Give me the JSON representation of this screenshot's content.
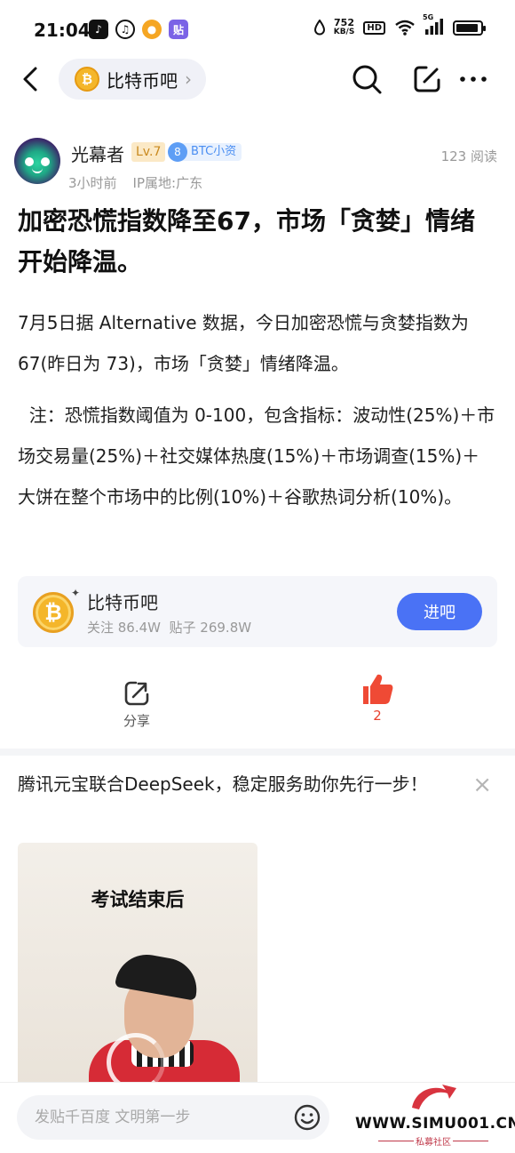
{
  "status_bar": {
    "time": "21:04",
    "speed_value": "752",
    "speed_unit": "KB/S",
    "hd": "HD",
    "network": "5G",
    "left_icons": [
      "tiktok-icon",
      "netease-icon",
      "weibo-icon",
      "tieba-icon"
    ],
    "right_icons": [
      "water-drop-icon",
      "wifi-icon",
      "signal-icon",
      "battery-icon"
    ]
  },
  "nav": {
    "forum_name": "比特币吧",
    "coin_symbol": "₿",
    "chevron": "›",
    "icons": [
      "back-icon",
      "search-icon",
      "edit-icon",
      "more-icon"
    ]
  },
  "post": {
    "author": "光幕者",
    "level": "Lv.7",
    "btc_level": "8",
    "btc_tag": "BTC小资",
    "reads": "123 阅读",
    "time_ago": "3小时前",
    "ip_location": "IP属地:广东",
    "title": "加密恐慌指数降至67，市场「贪婪」情绪开始降温。",
    "body": [
      "7月5日据 Alternative 数据，今日加密恐慌与贪婪指数为 67(昨日为 73)，市场「贪婪」情绪降温。",
      "  注：恐慌指数阈值为 0-100，包含指标：波动性(25%)＋市场交易量(25%)＋社交媒体热度(15%)＋市场调查(15%)＋大饼在整个市场中的比例(10%)＋谷歌热词分析(10%)。"
    ]
  },
  "forum_card": {
    "name": "比特币吧",
    "coin_symbol": "₿",
    "stats": "关注 86.4W  贴子 269.8W",
    "join_label": "进吧"
  },
  "actions": {
    "share_label": "分享",
    "like_count": "2"
  },
  "ad": {
    "title": "腾讯元宝联合DeepSeek，稳定服务助你先行一步！",
    "close": "×",
    "video_caption": "考试结束后"
  },
  "bottom": {
    "reply_placeholder": "发贴千百度 文明第一步"
  },
  "watermark": {
    "site": "WWW.SIMU001.CN",
    "sub": "私募社区"
  },
  "colors": {
    "accent_blue": "#4a72f5",
    "like_red": "#e8412e",
    "level_gold": "#c9891f",
    "btc_blue": "#4a8ef2"
  }
}
